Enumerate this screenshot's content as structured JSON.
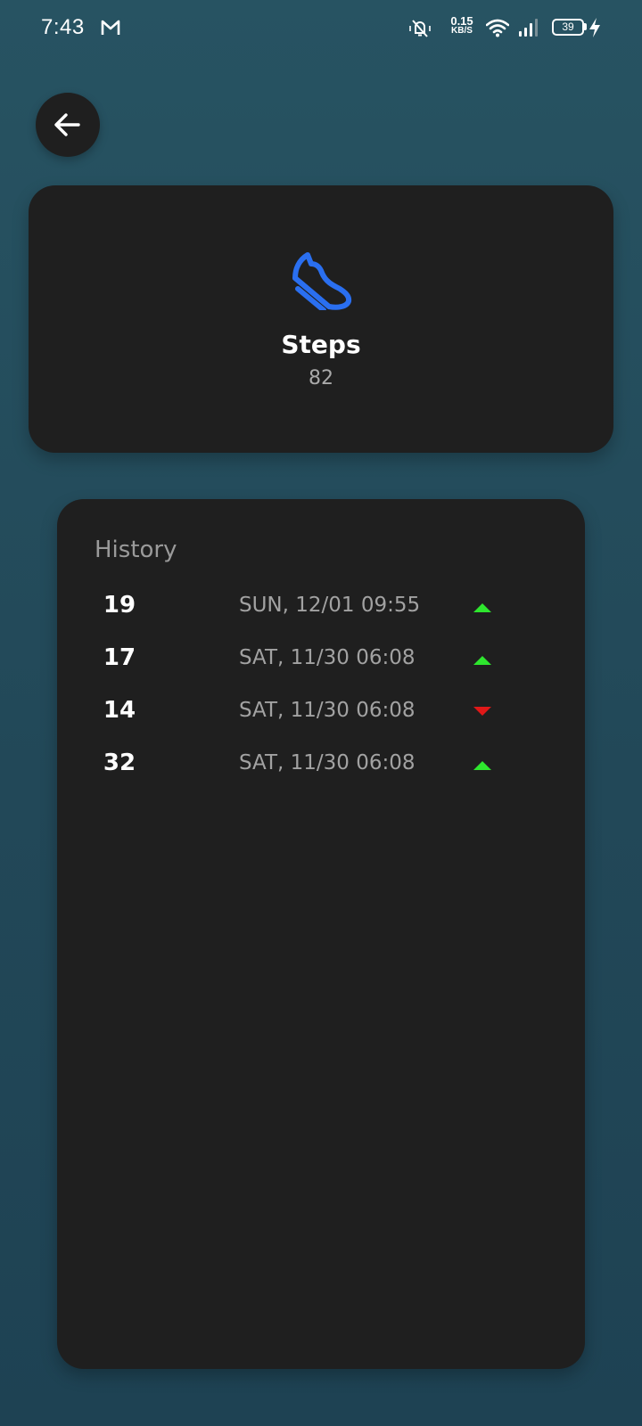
{
  "status_bar": {
    "time": "7:43",
    "net_speed_value": "0.15",
    "net_speed_unit": "KB/S",
    "battery_level": "39",
    "icons": [
      "gmail-icon",
      "bell-off-icon",
      "wifi-icon",
      "signal-icon",
      "battery-icon",
      "charging-bolt-icon"
    ]
  },
  "header": {
    "back_icon": "arrow-left-icon"
  },
  "steps_card": {
    "icon": "shoe-icon",
    "icon_color": "#2a6ff0",
    "title": "Steps",
    "value": "82"
  },
  "history": {
    "title": "History",
    "up_color": "#2ee62e",
    "down_color": "#e01818",
    "items": [
      {
        "value": "19",
        "date": "SUN, 12/01 09:55",
        "trend": "up"
      },
      {
        "value": "17",
        "date": "SAT, 11/30 06:08",
        "trend": "up"
      },
      {
        "value": "14",
        "date": "SAT, 11/30 06:08",
        "trend": "down"
      },
      {
        "value": "32",
        "date": "SAT, 11/30 06:08",
        "trend": "up"
      }
    ]
  }
}
